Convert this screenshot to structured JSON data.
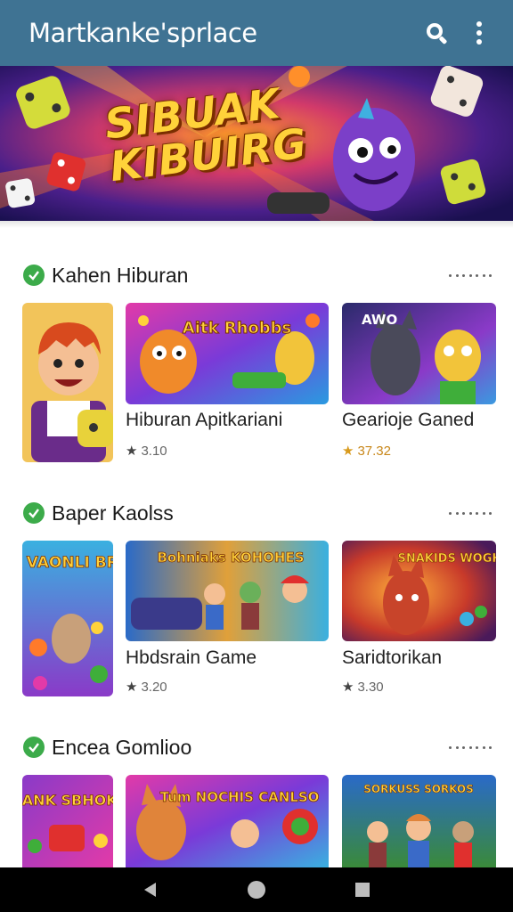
{
  "app_bar": {
    "title": "Martkanke'sprlace",
    "color": "#3f7393",
    "search_icon": "search-icon",
    "menu_icon": "more-vert-icon"
  },
  "banner": {
    "text_line1": "SIBUAK",
    "text_line2": "KIBUIRG"
  },
  "sections": [
    {
      "title": "Kahen Hiburan",
      "cards": [
        {
          "title": "",
          "rating": ""
        },
        {
          "title": "Hiburan Apitkariani",
          "rating": "3.10"
        },
        {
          "title": "Gearioje Ganed",
          "rating": "37.32"
        }
      ]
    },
    {
      "title": "Baper Kaolss",
      "cards": [
        {
          "title": "",
          "rating": ""
        },
        {
          "title": "Hbdsrain Game",
          "rating": "3.20"
        },
        {
          "title": "Saridtorikan",
          "rating": "3.30"
        }
      ]
    },
    {
      "title": "Encea Gomlioo",
      "cards": [
        {
          "title": "",
          "rating": ""
        },
        {
          "title": "",
          "rating": ""
        },
        {
          "title": "",
          "rating": ""
        }
      ]
    }
  ],
  "thumbnail_texts": {
    "s1c1": "Aitk Rhobbs",
    "s1c2": "AWO",
    "s2c0": "TAPCK VAONLI BROBIEE",
    "s2c1": "Bohniaks KOHOHES",
    "s2c2": "SNAKIDS WOGHES",
    "s3c0": "MANK SBHOKS",
    "s3c1": "Tum NOCHIS CANLSO",
    "s3c2": "SORKUSS SORKOS"
  },
  "nav": {
    "back_icon": "back-triangle-icon",
    "home_icon": "home-circle-icon",
    "recents_icon": "recents-square-icon"
  },
  "colors": {
    "accent": "#3cab4a",
    "rating_gold": "#c8871a"
  }
}
